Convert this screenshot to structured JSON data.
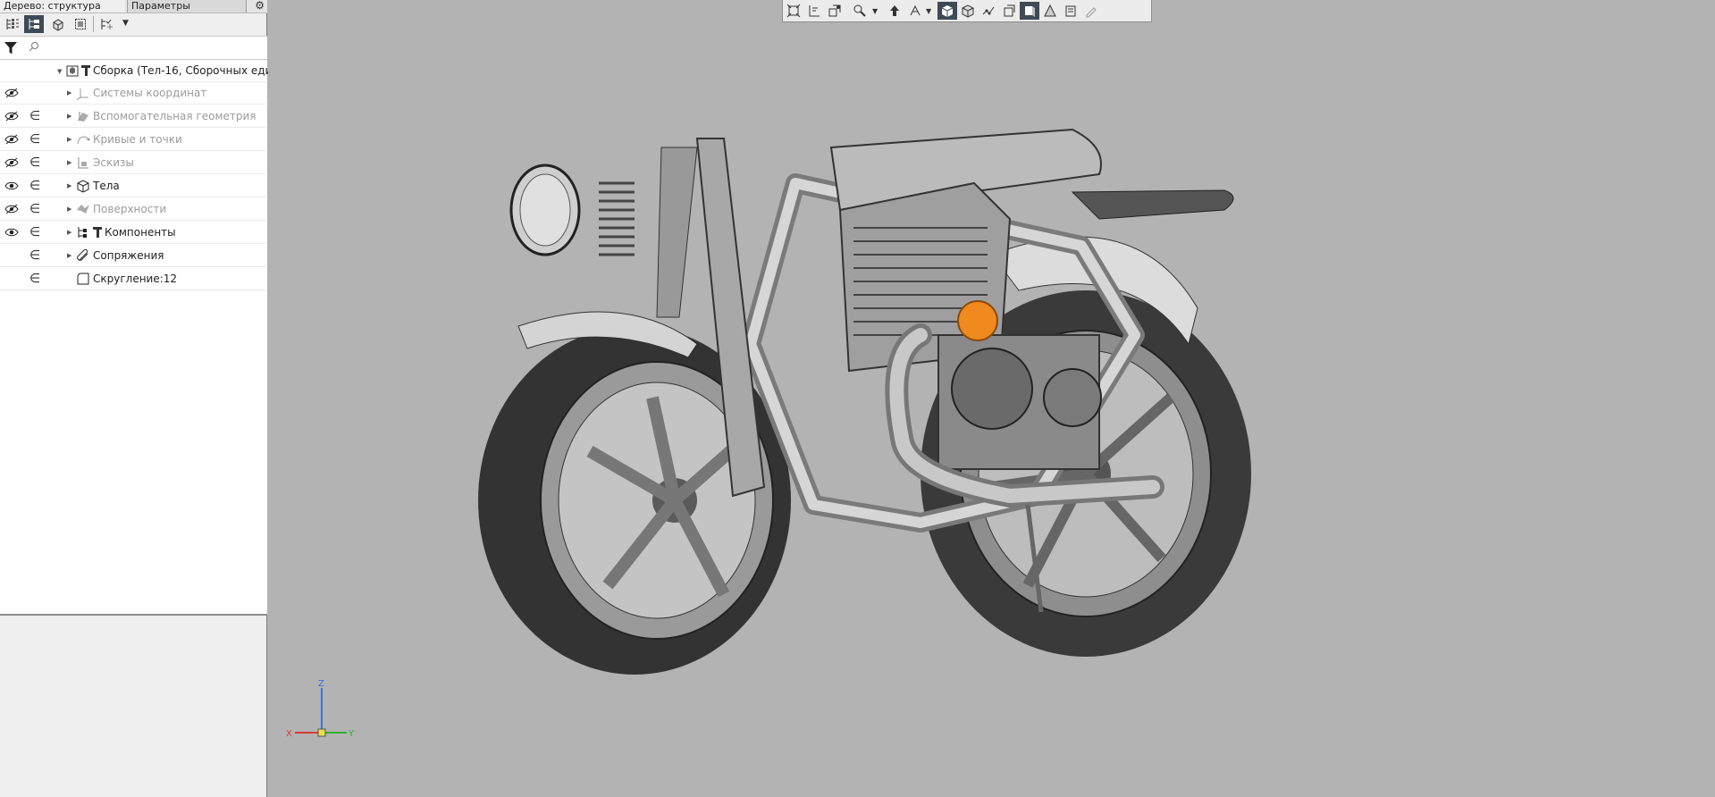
{
  "panel": {
    "tabs": {
      "tree": "Дерево: структура",
      "params": "Параметры"
    },
    "toolbar": {
      "icons": [
        "tree-by-order-icon",
        "tree-by-structure-icon",
        "bodies-view-icon",
        "selection-view-icon",
        "show-hide-icon"
      ]
    },
    "filter": {
      "placeholder": ""
    }
  },
  "tree": {
    "root": {
      "label": "Сборка (Тел-16, Сборочных еди",
      "icon": "assembly-icon"
    },
    "items": [
      {
        "label": "Системы координат",
        "icon": "coordinate-systems-icon",
        "visible": "hidden",
        "dim": true
      },
      {
        "label": "Вспомогательная геометрия",
        "icon": "aux-geometry-icon",
        "visible": "hidden",
        "dim": true
      },
      {
        "label": "Кривые и точки",
        "icon": "curves-points-icon",
        "visible": "hidden",
        "dim": true
      },
      {
        "label": "Эскизы",
        "icon": "sketches-icon",
        "visible": "hidden",
        "dim": true
      },
      {
        "label": "Тела",
        "icon": "bodies-icon",
        "visible": "shown",
        "dim": false
      },
      {
        "label": "Поверхности",
        "icon": "surfaces-icon",
        "visible": "hidden",
        "dim": true
      },
      {
        "label": "Компоненты",
        "icon": "components-icon",
        "visible": "shown",
        "dim": false
      },
      {
        "label": "Сопряжения",
        "icon": "mates-icon",
        "visible": "none",
        "dim": false
      },
      {
        "label": "Скругление:12",
        "icon": "fillet-icon",
        "visible": "none",
        "dim": false
      }
    ]
  },
  "viewport": {
    "toolbar_icons": [
      "zoom-to-fit-icon",
      "measure-icon",
      "view-orientation-icon",
      "zoom-icon",
      "rotate-icon",
      "pan-icon",
      "shaded-icon",
      "shaded-edges-icon",
      "wireframe-icon",
      "section-icon",
      "perspective-icon",
      "display-mode-icon",
      "materials-icon",
      "color-picker-icon"
    ],
    "triad": {
      "x": "X",
      "y": "Y",
      "z": "Z"
    },
    "colors": {
      "background": "#b3b3b3",
      "selected_part": "#f08a1e",
      "axis_x": "#d83b3b",
      "axis_y": "#2fb02f",
      "axis_z": "#3a6fd8"
    }
  }
}
